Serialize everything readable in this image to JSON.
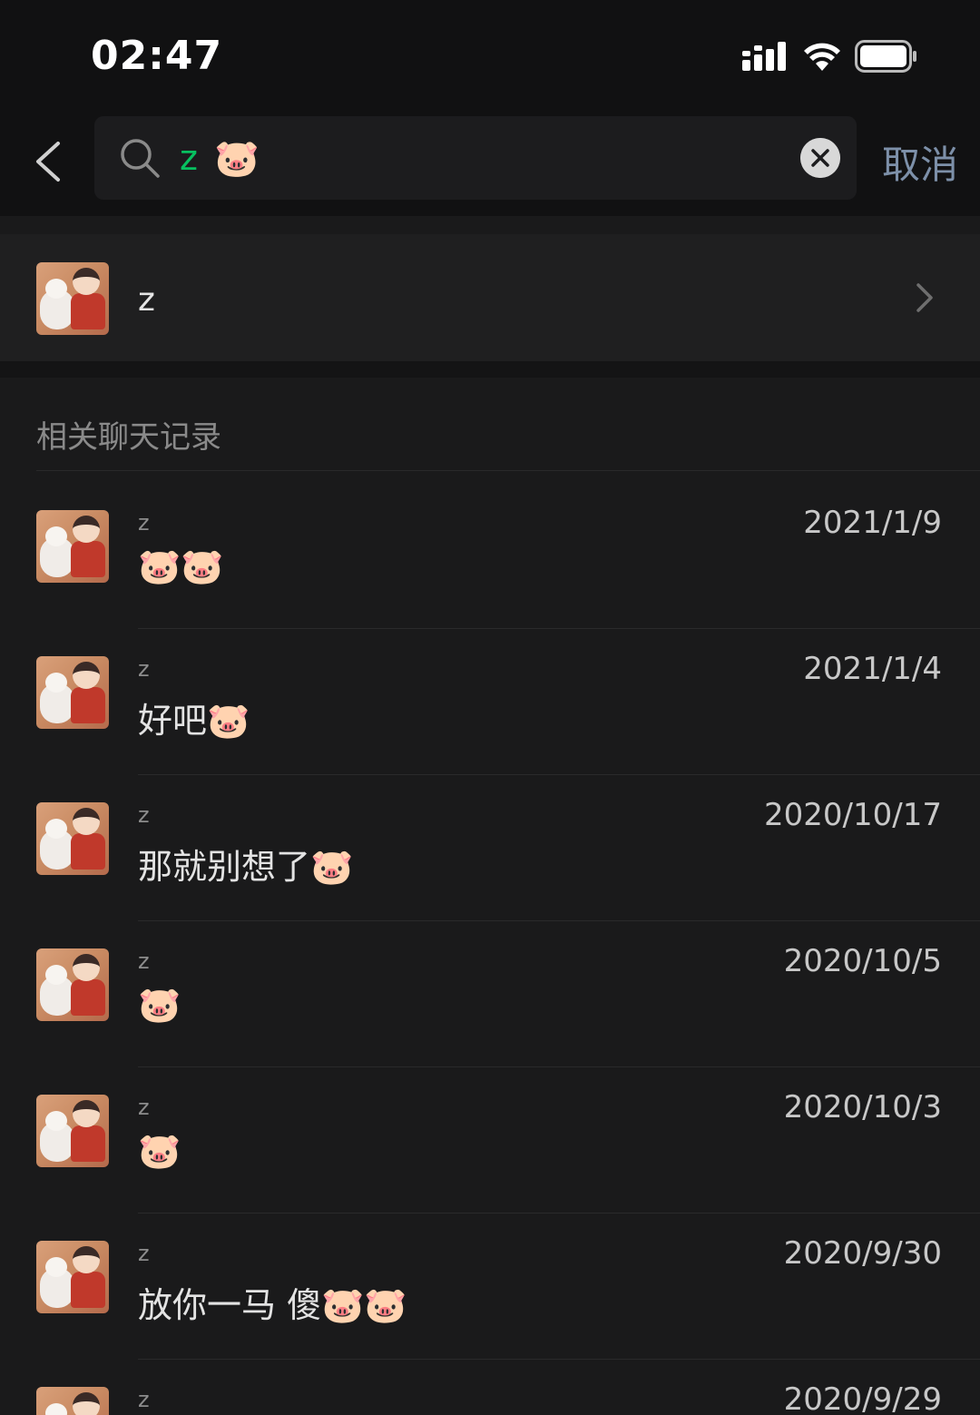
{
  "status_bar": {
    "time": "02:47",
    "icons": [
      "signal-icon",
      "wifi-icon",
      "battery-icon"
    ]
  },
  "search": {
    "query_text": "z",
    "query_emoji": "🐷",
    "cancel_label": "取消",
    "accent_color": "#07c160"
  },
  "contact": {
    "name": "z"
  },
  "section_title": "相关聊天记录",
  "records": [
    {
      "sender": "z",
      "message": "🐷🐷",
      "date": "2021/1/9"
    },
    {
      "sender": "z",
      "message": "好吧🐷",
      "date": "2021/1/4"
    },
    {
      "sender": "z",
      "message": "那就别想了🐷",
      "date": "2020/10/17"
    },
    {
      "sender": "z",
      "message": "🐷",
      "date": "2020/10/5"
    },
    {
      "sender": "z",
      "message": "🐷",
      "date": "2020/10/3"
    },
    {
      "sender": "z",
      "message": "放你一马 傻🐷🐷",
      "date": "2020/9/30"
    },
    {
      "sender": "z",
      "message": "",
      "date": "2020/9/29"
    }
  ]
}
